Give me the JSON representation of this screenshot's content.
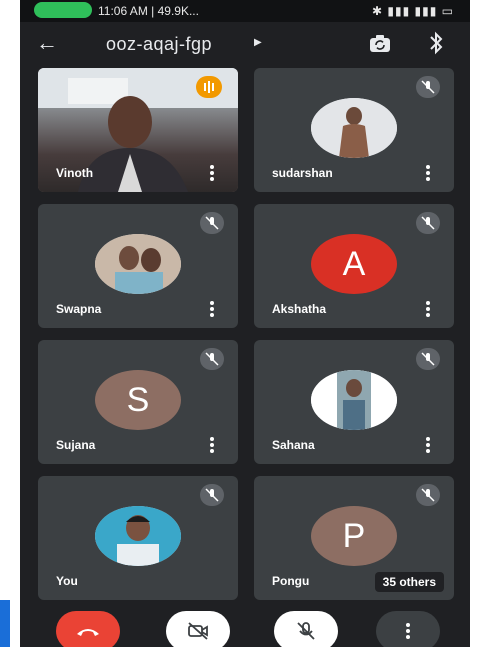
{
  "status_bar": {
    "time": "11:06 AM | 49.9K...",
    "indicator_color": "#2fbf5a"
  },
  "header": {
    "meeting_code": "ooz-aqaj-fgp",
    "back_icon": "arrow-left-icon",
    "switch_camera_icon": "switch-camera-icon",
    "audio_icon": "bluetooth-icon"
  },
  "participants": [
    {
      "name": "Vinoth",
      "type": "video",
      "speaking": true
    },
    {
      "name": "sudarshan",
      "type": "photo",
      "muted": true
    },
    {
      "name": "Swapna",
      "type": "photo",
      "muted": true
    },
    {
      "name": "Akshatha",
      "type": "initial",
      "initial": "A",
      "avatar_color": "#d93025",
      "muted": true
    },
    {
      "name": "Sujana",
      "type": "initial",
      "initial": "S",
      "avatar_color": "#8d6e63",
      "muted": true
    },
    {
      "name": "Sahana",
      "type": "photo",
      "muted": true
    },
    {
      "name": "You",
      "type": "photo",
      "muted": true
    },
    {
      "name": "Pongu",
      "type": "initial",
      "initial": "P",
      "avatar_color": "#8d6e63",
      "muted": true
    }
  ],
  "others_badge": "35 others",
  "controls": {
    "hangup_color": "#ea4335",
    "hangup_icon": "phone-hangup-icon",
    "camera_icon": "camera-off-icon",
    "mic_icon": "mic-off-icon",
    "more_icon": "more-vert-icon"
  }
}
